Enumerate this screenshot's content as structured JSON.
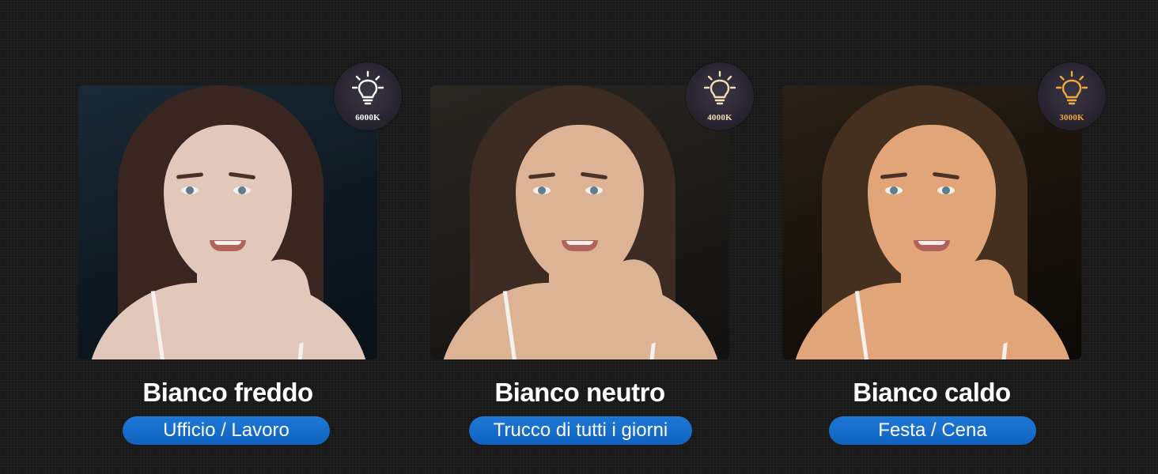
{
  "panels": [
    {
      "badge_text": "6000K",
      "badge_color": "#ffffff",
      "bulb_icon": "lightbulb-icon",
      "title": "Bianco freddo",
      "subtitle": "Ufficio / Lavoro"
    },
    {
      "badge_text": "4000K",
      "badge_color": "#f3dfb4",
      "bulb_icon": "lightbulb-icon",
      "title": "Bianco neutro",
      "subtitle": "Trucco di tutti i giorni"
    },
    {
      "badge_text": "3000K",
      "badge_color": "#f2a93b",
      "bulb_icon": "lightbulb-icon",
      "title": "Bianco caldo",
      "subtitle": "Festa / Cena"
    }
  ],
  "colors": {
    "background": "#1c1c1c",
    "pill": "#1669c8",
    "caption": "#ffffff"
  }
}
